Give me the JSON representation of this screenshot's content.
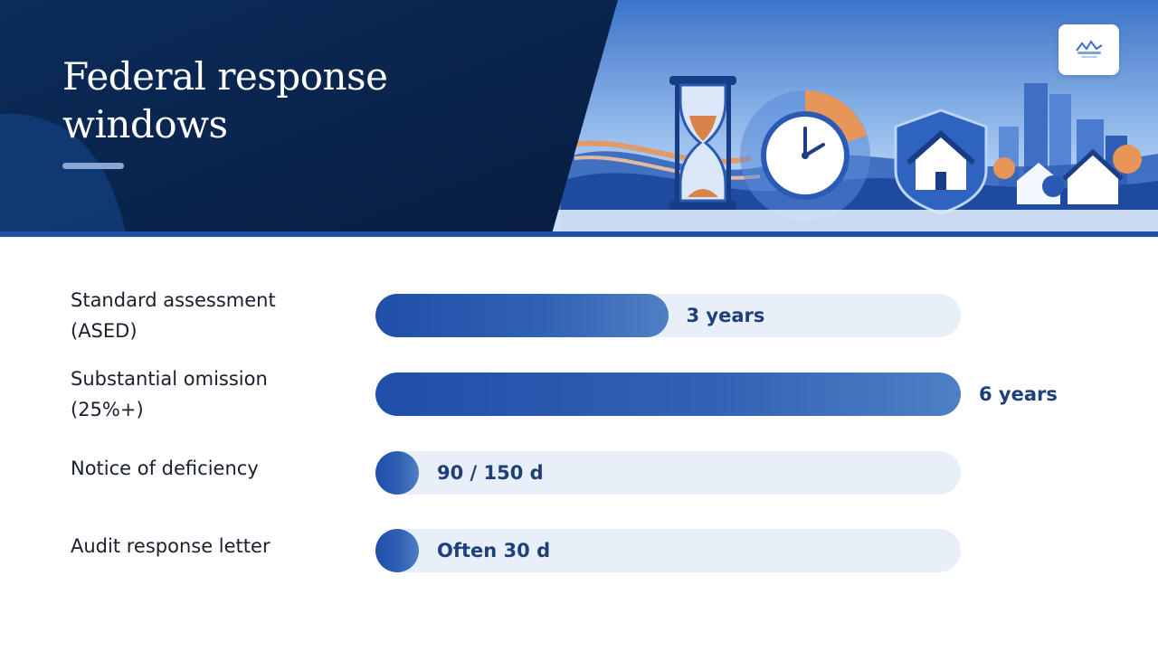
{
  "slide": {
    "title": "Federal response windows"
  },
  "colors": {
    "header_navy": "#0b2a55",
    "bar_blue": "#2457ad",
    "track": "#e9eff8",
    "value_text": "#1e3f7a",
    "accent_orange": "#e8955a"
  },
  "icons": [
    "hourglass-icon",
    "clock-icon",
    "shield-house-icon",
    "logo-icon"
  ],
  "chart_data": {
    "type": "bar",
    "orientation": "horizontal",
    "categories": [
      [
        "Standard assessment",
        "(ASED)"
      ],
      [
        "Substantial omission",
        "(25%+)"
      ],
      [
        "Notice of deficiency"
      ],
      [
        "Audit response letter"
      ]
    ],
    "series": [
      {
        "fill_fraction": [
          0.5,
          1.0,
          0.074,
          0.074
        ],
        "data_labels": [
          "3 years",
          "6 years",
          "90 / 150 d",
          "Often 30 d"
        ]
      }
    ],
    "xlim": [
      0,
      6
    ],
    "grid": false,
    "legend": "none"
  }
}
